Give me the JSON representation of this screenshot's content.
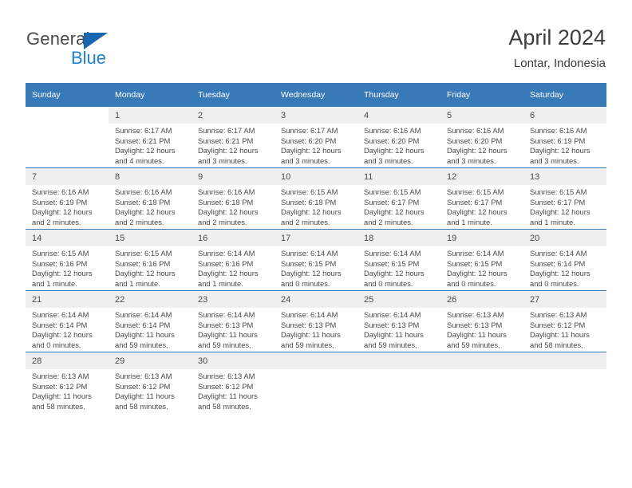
{
  "brand": {
    "name_part1": "General",
    "name_part2": "Blue",
    "accent_color": "#1f7fd0",
    "triangle_color": "#1666b0"
  },
  "header": {
    "title": "April 2024",
    "subtitle": "Lontar, Indonesia"
  },
  "theme": {
    "header_row_color": "#3879b8",
    "daynum_band_color": "#efefef",
    "text_color": "#4a4a4a"
  },
  "weekday_headers": [
    "Sunday",
    "Monday",
    "Tuesday",
    "Wednesday",
    "Thursday",
    "Friday",
    "Saturday"
  ],
  "labels": {
    "sunrise_prefix": "Sunrise:",
    "sunset_prefix": "Sunset:",
    "daylight_prefix": "Daylight:"
  },
  "weeks": [
    [
      {
        "day": "",
        "sunrise": "",
        "sunset": "",
        "daylight_line1": "",
        "daylight_line2": ""
      },
      {
        "day": "1",
        "sunrise": "Sunrise: 6:17 AM",
        "sunset": "Sunset: 6:21 PM",
        "daylight_line1": "Daylight: 12 hours",
        "daylight_line2": "and 4 minutes."
      },
      {
        "day": "2",
        "sunrise": "Sunrise: 6:17 AM",
        "sunset": "Sunset: 6:21 PM",
        "daylight_line1": "Daylight: 12 hours",
        "daylight_line2": "and 3 minutes."
      },
      {
        "day": "3",
        "sunrise": "Sunrise: 6:17 AM",
        "sunset": "Sunset: 6:20 PM",
        "daylight_line1": "Daylight: 12 hours",
        "daylight_line2": "and 3 minutes."
      },
      {
        "day": "4",
        "sunrise": "Sunrise: 6:16 AM",
        "sunset": "Sunset: 6:20 PM",
        "daylight_line1": "Daylight: 12 hours",
        "daylight_line2": "and 3 minutes."
      },
      {
        "day": "5",
        "sunrise": "Sunrise: 6:16 AM",
        "sunset": "Sunset: 6:20 PM",
        "daylight_line1": "Daylight: 12 hours",
        "daylight_line2": "and 3 minutes."
      },
      {
        "day": "6",
        "sunrise": "Sunrise: 6:16 AM",
        "sunset": "Sunset: 6:19 PM",
        "daylight_line1": "Daylight: 12 hours",
        "daylight_line2": "and 3 minutes."
      }
    ],
    [
      {
        "day": "7",
        "sunrise": "Sunrise: 6:16 AM",
        "sunset": "Sunset: 6:19 PM",
        "daylight_line1": "Daylight: 12 hours",
        "daylight_line2": "and 2 minutes."
      },
      {
        "day": "8",
        "sunrise": "Sunrise: 6:16 AM",
        "sunset": "Sunset: 6:18 PM",
        "daylight_line1": "Daylight: 12 hours",
        "daylight_line2": "and 2 minutes."
      },
      {
        "day": "9",
        "sunrise": "Sunrise: 6:16 AM",
        "sunset": "Sunset: 6:18 PM",
        "daylight_line1": "Daylight: 12 hours",
        "daylight_line2": "and 2 minutes."
      },
      {
        "day": "10",
        "sunrise": "Sunrise: 6:15 AM",
        "sunset": "Sunset: 6:18 PM",
        "daylight_line1": "Daylight: 12 hours",
        "daylight_line2": "and 2 minutes."
      },
      {
        "day": "11",
        "sunrise": "Sunrise: 6:15 AM",
        "sunset": "Sunset: 6:17 PM",
        "daylight_line1": "Daylight: 12 hours",
        "daylight_line2": "and 2 minutes."
      },
      {
        "day": "12",
        "sunrise": "Sunrise: 6:15 AM",
        "sunset": "Sunset: 6:17 PM",
        "daylight_line1": "Daylight: 12 hours",
        "daylight_line2": "and 1 minute."
      },
      {
        "day": "13",
        "sunrise": "Sunrise: 6:15 AM",
        "sunset": "Sunset: 6:17 PM",
        "daylight_line1": "Daylight: 12 hours",
        "daylight_line2": "and 1 minute."
      }
    ],
    [
      {
        "day": "14",
        "sunrise": "Sunrise: 6:15 AM",
        "sunset": "Sunset: 6:16 PM",
        "daylight_line1": "Daylight: 12 hours",
        "daylight_line2": "and 1 minute."
      },
      {
        "day": "15",
        "sunrise": "Sunrise: 6:15 AM",
        "sunset": "Sunset: 6:16 PM",
        "daylight_line1": "Daylight: 12 hours",
        "daylight_line2": "and 1 minute."
      },
      {
        "day": "16",
        "sunrise": "Sunrise: 6:14 AM",
        "sunset": "Sunset: 6:16 PM",
        "daylight_line1": "Daylight: 12 hours",
        "daylight_line2": "and 1 minute."
      },
      {
        "day": "17",
        "sunrise": "Sunrise: 6:14 AM",
        "sunset": "Sunset: 6:15 PM",
        "daylight_line1": "Daylight: 12 hours",
        "daylight_line2": "and 0 minutes."
      },
      {
        "day": "18",
        "sunrise": "Sunrise: 6:14 AM",
        "sunset": "Sunset: 6:15 PM",
        "daylight_line1": "Daylight: 12 hours",
        "daylight_line2": "and 0 minutes."
      },
      {
        "day": "19",
        "sunrise": "Sunrise: 6:14 AM",
        "sunset": "Sunset: 6:15 PM",
        "daylight_line1": "Daylight: 12 hours",
        "daylight_line2": "and 0 minutes."
      },
      {
        "day": "20",
        "sunrise": "Sunrise: 6:14 AM",
        "sunset": "Sunset: 6:14 PM",
        "daylight_line1": "Daylight: 12 hours",
        "daylight_line2": "and 0 minutes."
      }
    ],
    [
      {
        "day": "21",
        "sunrise": "Sunrise: 6:14 AM",
        "sunset": "Sunset: 6:14 PM",
        "daylight_line1": "Daylight: 12 hours",
        "daylight_line2": "and 0 minutes."
      },
      {
        "day": "22",
        "sunrise": "Sunrise: 6:14 AM",
        "sunset": "Sunset: 6:14 PM",
        "daylight_line1": "Daylight: 11 hours",
        "daylight_line2": "and 59 minutes."
      },
      {
        "day": "23",
        "sunrise": "Sunrise: 6:14 AM",
        "sunset": "Sunset: 6:13 PM",
        "daylight_line1": "Daylight: 11 hours",
        "daylight_line2": "and 59 minutes."
      },
      {
        "day": "24",
        "sunrise": "Sunrise: 6:14 AM",
        "sunset": "Sunset: 6:13 PM",
        "daylight_line1": "Daylight: 11 hours",
        "daylight_line2": "and 59 minutes."
      },
      {
        "day": "25",
        "sunrise": "Sunrise: 6:14 AM",
        "sunset": "Sunset: 6:13 PM",
        "daylight_line1": "Daylight: 11 hours",
        "daylight_line2": "and 59 minutes."
      },
      {
        "day": "26",
        "sunrise": "Sunrise: 6:13 AM",
        "sunset": "Sunset: 6:13 PM",
        "daylight_line1": "Daylight: 11 hours",
        "daylight_line2": "and 59 minutes."
      },
      {
        "day": "27",
        "sunrise": "Sunrise: 6:13 AM",
        "sunset": "Sunset: 6:12 PM",
        "daylight_line1": "Daylight: 11 hours",
        "daylight_line2": "and 58 minutes."
      }
    ],
    [
      {
        "day": "28",
        "sunrise": "Sunrise: 6:13 AM",
        "sunset": "Sunset: 6:12 PM",
        "daylight_line1": "Daylight: 11 hours",
        "daylight_line2": "and 58 minutes."
      },
      {
        "day": "29",
        "sunrise": "Sunrise: 6:13 AM",
        "sunset": "Sunset: 6:12 PM",
        "daylight_line1": "Daylight: 11 hours",
        "daylight_line2": "and 58 minutes."
      },
      {
        "day": "30",
        "sunrise": "Sunrise: 6:13 AM",
        "sunset": "Sunset: 6:12 PM",
        "daylight_line1": "Daylight: 11 hours",
        "daylight_line2": "and 58 minutes."
      },
      {
        "day": "",
        "sunrise": "",
        "sunset": "",
        "daylight_line1": "",
        "daylight_line2": ""
      },
      {
        "day": "",
        "sunrise": "",
        "sunset": "",
        "daylight_line1": "",
        "daylight_line2": ""
      },
      {
        "day": "",
        "sunrise": "",
        "sunset": "",
        "daylight_line1": "",
        "daylight_line2": ""
      },
      {
        "day": "",
        "sunrise": "",
        "sunset": "",
        "daylight_line1": "",
        "daylight_line2": ""
      }
    ]
  ]
}
